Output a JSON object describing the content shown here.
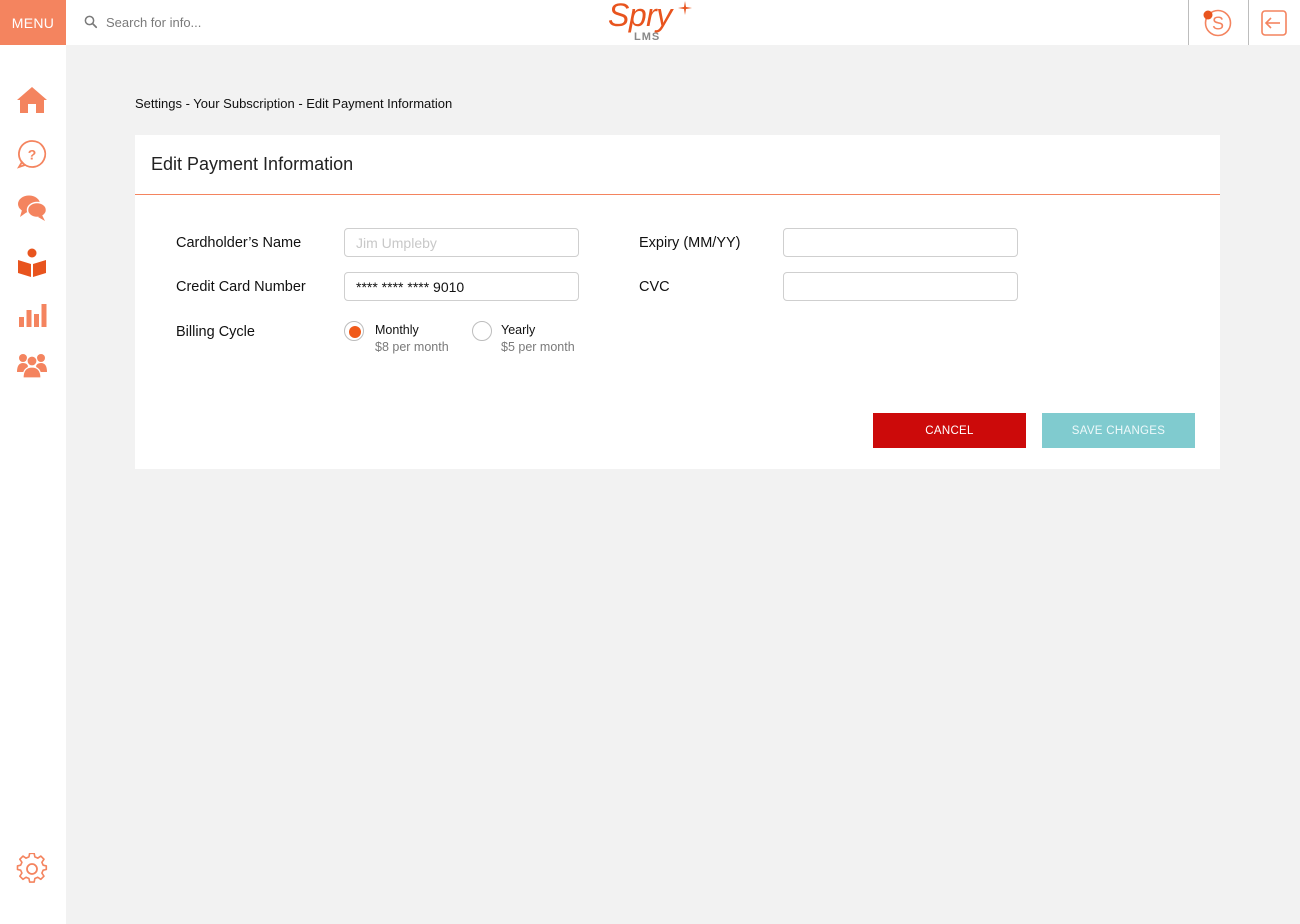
{
  "header": {
    "menu_label": "MENU",
    "search_placeholder": "Search for info...",
    "logo_text": "Spry",
    "logo_subtext": "LMS",
    "profile_icon": "profile-s-icon",
    "logout_icon": "logout-icon"
  },
  "sidebar": {
    "items": [
      {
        "icon": "home-icon"
      },
      {
        "icon": "help-icon"
      },
      {
        "icon": "chat-icon"
      },
      {
        "icon": "book-reader-icon"
      },
      {
        "icon": "bar-chart-icon"
      },
      {
        "icon": "users-icon"
      }
    ],
    "settings_icon": "gear-icon"
  },
  "breadcrumb": "Settings - Your Subscription - Edit Payment Information",
  "form": {
    "title": "Edit Payment Information",
    "cardholder_label": "Cardholder’s Name",
    "cardholder_placeholder": "Jim Umpleby",
    "cardholder_value": "",
    "card_number_label": "Credit Card Number",
    "card_number_value": "**** **** **** 9010",
    "expiry_label": "Expiry (MM/YY)",
    "expiry_value": "",
    "cvc_label": "CVC",
    "cvc_value": "",
    "billing_label": "Billing Cycle",
    "billing_options": [
      {
        "title": "Monthly",
        "price": "$8 per month",
        "selected": true
      },
      {
        "title": "Yearly",
        "price": "$5 per month",
        "selected": false
      }
    ],
    "cancel_label": "CANCEL",
    "save_label": "SAVE CHANGES"
  },
  "colors": {
    "accent": "#f4845f",
    "brand": "#e8541e",
    "cancel": "#cc0a0a",
    "save": "#80cbcf",
    "background": "#f2f2f2"
  }
}
